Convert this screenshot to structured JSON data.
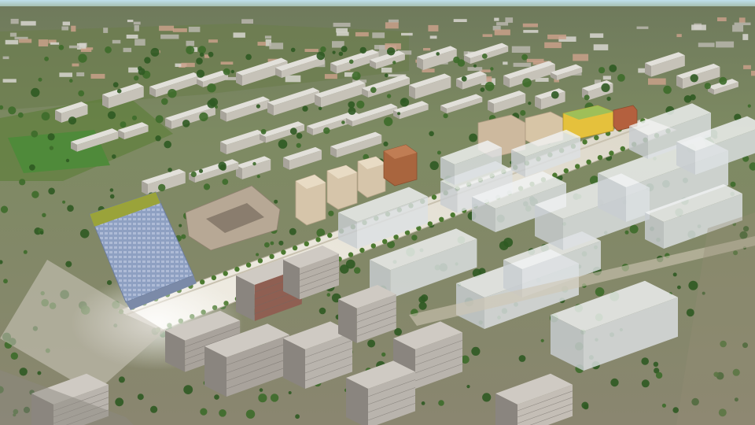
{
  "scene": {
    "kind": "aerial-3d-city-render",
    "colors": {
      "sky": "#cfe3ea",
      "far_terrain": "#6f7a5c",
      "mid_terrain": "#7d8a62",
      "near_terrain": "#8c8a6e",
      "boulevard": "#e6e2d6",
      "sidewalk": "#d9d3c4",
      "glass_blocks": "#e8ecef",
      "tower_facade": "#8ea0c2",
      "tower_roof": "#9aa33a",
      "brick_building": "#a0603a",
      "beige_building": "#d3c1a7",
      "yellow_building": "#e5c13c",
      "grey_block": "#b8b2aa",
      "tree": "#3d6b2a",
      "field": "#5e8a3e"
    },
    "icons": [
      "boulevard-road",
      "tall-tower",
      "tree-row",
      "glass-building-block",
      "existing-housing-block"
    ]
  }
}
